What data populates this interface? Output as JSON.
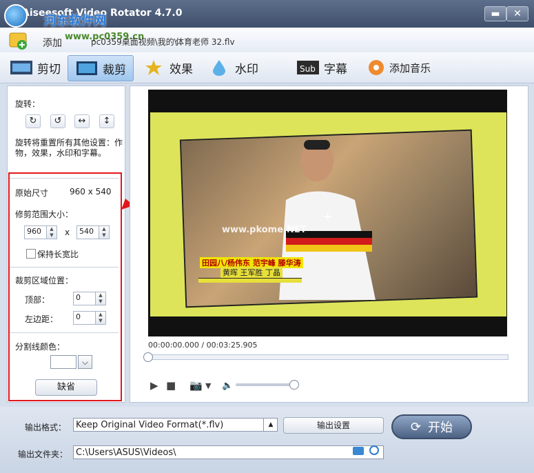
{
  "window": {
    "title": "Aiseesoft Video Rotator 4.7.0",
    "minimize": "▬",
    "close": "✕"
  },
  "watermark": {
    "text": "河东软件网",
    "site": "www.pc0359.cn"
  },
  "add_bar": {
    "add_label": "添加",
    "path": "pc0359桌面视频\\我的\\",
    "file": "体育老师 32.flv"
  },
  "tabs": [
    {
      "label": "剪切",
      "icon": "film-icon"
    },
    {
      "label": "裁剪",
      "icon": "crop-icon",
      "active": true
    },
    {
      "label": "效果",
      "icon": "effects-icon"
    },
    {
      "label": "水印",
      "icon": "watermark-icon"
    },
    {
      "label": "字幕",
      "icon": "subtitle-icon"
    },
    {
      "label": "添加音乐",
      "icon": "music-icon"
    }
  ],
  "sidebar": {
    "rotate_label": "旋转：",
    "rotate_buttons": [
      "↻",
      "↺",
      "↔",
      "↕"
    ],
    "rotate_note": "旋转将重置所有其他设置：作物，效果，水印和字幕。",
    "original_size_label": "原始尺寸",
    "original_size_value": "960 x 540",
    "crop_size_label": "修剪范围大小：",
    "crop_width": "960",
    "crop_x": "x",
    "crop_height": "540",
    "keep_ratio_label": "保持长宽比",
    "crop_pos_label": "裁剪区域位置：",
    "top_label": "顶部：",
    "top_value": "0",
    "left_label": "左边距：",
    "left_value": "0",
    "divider_color_label": "分割线颜色：",
    "default_button": "缺省"
  },
  "preview": {
    "timecode": "00:00:00.000 / 00:03:25.905",
    "video_watermark": "www.pkome.NET",
    "caption_line1": "田园八/杨伟东 范宇峰 滕华涛",
    "caption_line2": "黄晖 王军胜 丁晶",
    "progress": 0.0,
    "volume": 0.88
  },
  "bottom": {
    "output_format_label": "输出格式：",
    "output_format_value": "Keep Original Video Format(*.flv)",
    "output_settings_button": "输出设置",
    "output_folder_label": "输出文件夹：",
    "output_folder_value": "C:\\Users\\ASUS\\Videos\\",
    "start_button": "开始"
  },
  "colors": {
    "highlight": "#e0161c",
    "accent": "#3b6fb6"
  }
}
